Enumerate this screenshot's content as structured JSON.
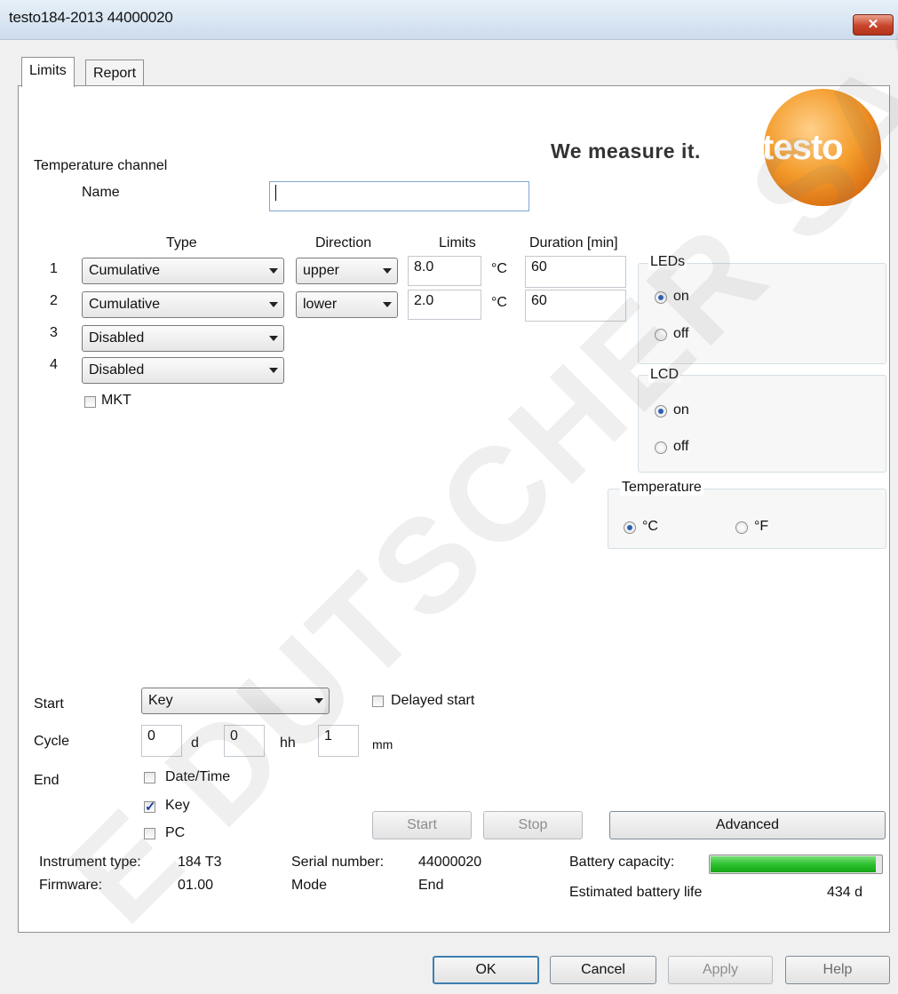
{
  "window": {
    "title": "testo184-2013 44000020",
    "close_glyph": "✕"
  },
  "tabs": [
    {
      "label": "Limits"
    },
    {
      "label": "Report"
    }
  ],
  "logo": {
    "slogan": "We measure it.",
    "brand": "testo"
  },
  "channel": {
    "section_label": "Temperature channel",
    "name_label": "Name",
    "name_value": ""
  },
  "limits_table": {
    "headers": {
      "type": "Type",
      "direction": "Direction",
      "limits": "Limits",
      "duration": "Duration [min]"
    },
    "rows": [
      {
        "num": "1",
        "type": "Cumulative",
        "direction": "upper",
        "limit": "8.0",
        "unit": "°C",
        "duration": "60"
      },
      {
        "num": "2",
        "type": "Cumulative",
        "direction": "lower",
        "limit": "2.0",
        "unit": "°C",
        "duration": "60"
      },
      {
        "num": "3",
        "type": "Disabled"
      },
      {
        "num": "4",
        "type": "Disabled"
      }
    ],
    "mkt_label": "MKT"
  },
  "leds": {
    "title": "LEDs",
    "on": "on",
    "off": "off",
    "selected": "on"
  },
  "lcd": {
    "title": "LCD",
    "on": "on",
    "off": "off",
    "selected": "on"
  },
  "temperature": {
    "title": "Temperature",
    "c": "°C",
    "f": "°F",
    "selected": "°C"
  },
  "start": {
    "label": "Start",
    "value": "Key",
    "delayed_label": "Delayed start"
  },
  "cycle": {
    "label": "Cycle",
    "d_value": "0",
    "d_unit": "d",
    "hh_value": "0",
    "hh_unit": "hh",
    "mm_value": "1",
    "mm_unit": "mm"
  },
  "end": {
    "label": "End",
    "datetime": "Date/Time",
    "key": "Key",
    "pc": "PC"
  },
  "actions": {
    "start": "Start",
    "stop": "Stop",
    "advanced": "Advanced"
  },
  "info": {
    "instrument_type_label": "Instrument type:",
    "instrument_type": "184 T3",
    "firmware_label": "Firmware:",
    "firmware": "01.00",
    "serial_label": "Serial number:",
    "serial": "44000020",
    "mode_label": "Mode",
    "mode": "End",
    "battery_label": "Battery capacity:",
    "battery_level": 0.97,
    "life_label": "Estimated battery life",
    "life": "434 d"
  },
  "footer": {
    "ok": "OK",
    "cancel": "Cancel",
    "apply": "Apply",
    "help": "Help"
  },
  "watermark": "E DUTSCHER SAS"
}
